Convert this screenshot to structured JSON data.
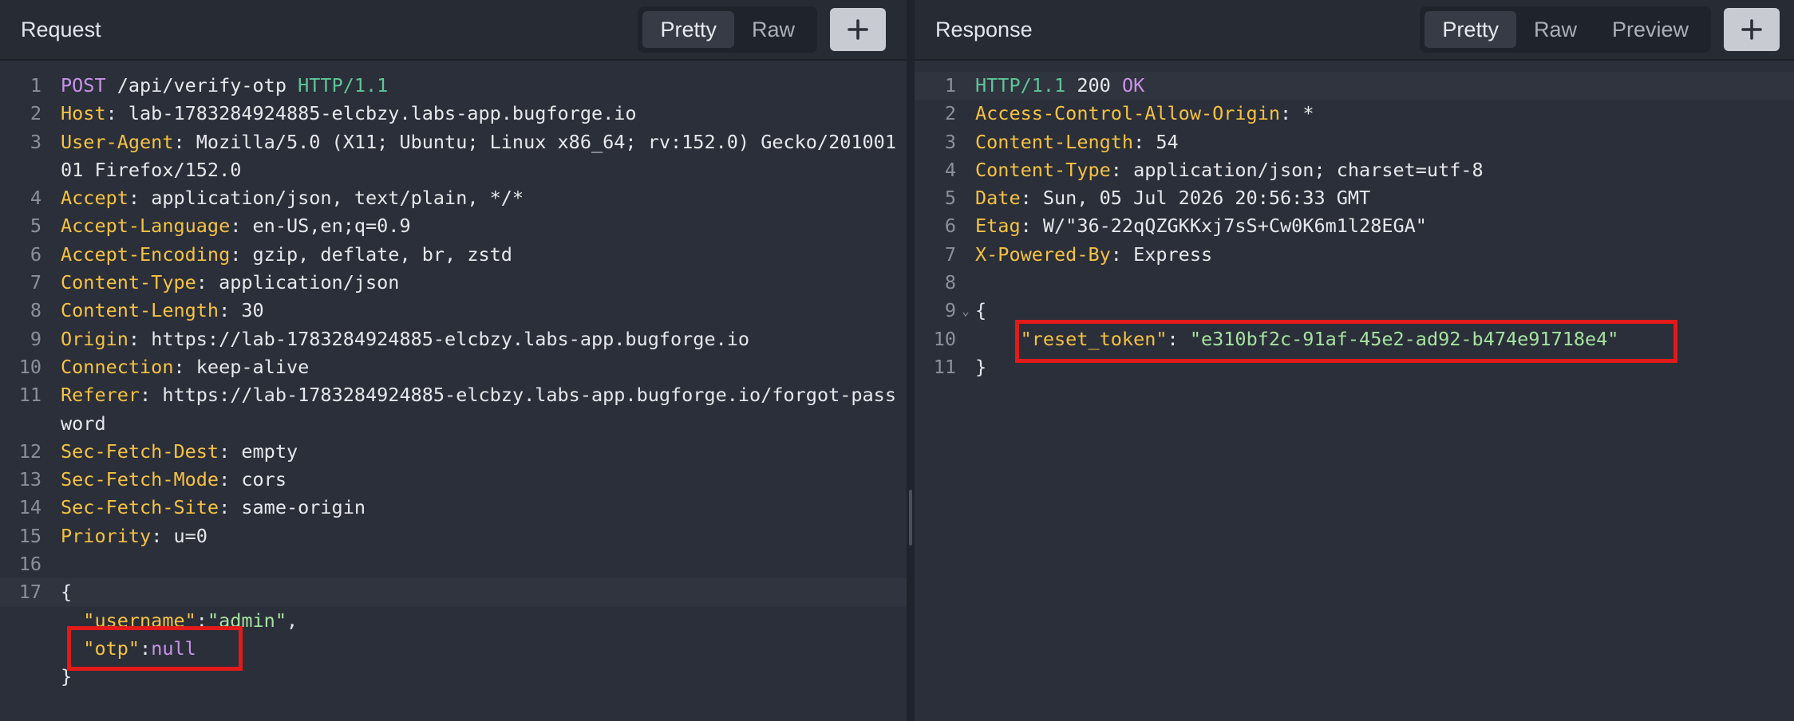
{
  "request": {
    "title": "Request",
    "view_tabs": [
      "Pretty",
      "Raw"
    ],
    "active_tab": "Pretty",
    "add_button_icon": "plus-icon",
    "request_line": {
      "method": "POST",
      "path": " /api/verify-otp ",
      "protocol": "HTTP/1.1"
    },
    "headers": [
      {
        "name": "Host",
        "value": "lab-1783284924885-elcbzy.labs-app.bugforge.io"
      },
      {
        "name": "User-Agent",
        "value": "Mozilla/5.0 (X11; Ubuntu; Linux x86_64; rv:152.0) Gecko/20100101 Firefox/152.0"
      },
      {
        "name": "Accept",
        "value": "application/json, text/plain, */*"
      },
      {
        "name": "Accept-Language",
        "value": "en-US,en;q=0.9"
      },
      {
        "name": "Accept-Encoding",
        "value": "gzip, deflate, br, zstd"
      },
      {
        "name": "Content-Type",
        "value": "application/json"
      },
      {
        "name": "Content-Length",
        "value": "30"
      },
      {
        "name": "Origin",
        "value": "https://lab-1783284924885-elcbzy.labs-app.bugforge.io"
      },
      {
        "name": "Connection",
        "value": "keep-alive"
      },
      {
        "name": "Referer",
        "value": "https://lab-1783284924885-elcbzy.labs-app.bugforge.io/forgot-password"
      },
      {
        "name": "Sec-Fetch-Dest",
        "value": "empty"
      },
      {
        "name": "Sec-Fetch-Mode",
        "value": "cors"
      },
      {
        "name": "Sec-Fetch-Site",
        "value": "same-origin"
      },
      {
        "name": "Priority",
        "value": "u=0"
      }
    ],
    "body_open": "{",
    "body_close": "}",
    "body_fields": [
      {
        "key": "\"username\"",
        "value": "\"admin\"",
        "suffix": ","
      },
      {
        "key": "\"otp\"",
        "value": "null",
        "suffix": ""
      }
    ],
    "line_numbers": [
      "1",
      "2",
      "3",
      "4",
      "5",
      "6",
      "7",
      "8",
      "9",
      "10",
      "11",
      "12",
      "13",
      "14",
      "15",
      "16",
      "17"
    ]
  },
  "response": {
    "title": "Response",
    "view_tabs": [
      "Pretty",
      "Raw",
      "Preview"
    ],
    "active_tab": "Pretty",
    "add_button_icon": "plus-icon",
    "status_line": {
      "protocol": "HTTP/1.1",
      "code": " 200 ",
      "text": "OK"
    },
    "headers": [
      {
        "name": "Access-Control-Allow-Origin",
        "value": "*"
      },
      {
        "name": "Content-Length",
        "value": "54"
      },
      {
        "name": "Content-Type",
        "value": "application/json; charset=utf-8"
      },
      {
        "name": "Date",
        "value": "Sun, 05 Jul 2026 20:56:33 GMT"
      },
      {
        "name": "Etag",
        "value": "W/\"36-22qQZGKKxj7sS+Cw0K6m1l28EGA\""
      },
      {
        "name": "X-Powered-By",
        "value": "Express"
      }
    ],
    "body_open": "{",
    "body_close": "}",
    "body_fields": [
      {
        "key": "\"reset_token\"",
        "value": "\"e310bf2c-91af-45e2-ad92-b474e91718e4\""
      }
    ],
    "fold_icon": "chevron-down-icon",
    "fold_glyph": "⌄",
    "line_numbers": [
      "1",
      "2",
      "3",
      "4",
      "5",
      "6",
      "7",
      "8",
      "9",
      "10",
      "11"
    ]
  },
  "colors": {
    "background": "#2b2f39",
    "header_name": "#f5c242",
    "method": "#c792ea",
    "protocol": "#5fc59a",
    "string": "#a6e3a1",
    "highlight_box": "#e21a1a"
  }
}
